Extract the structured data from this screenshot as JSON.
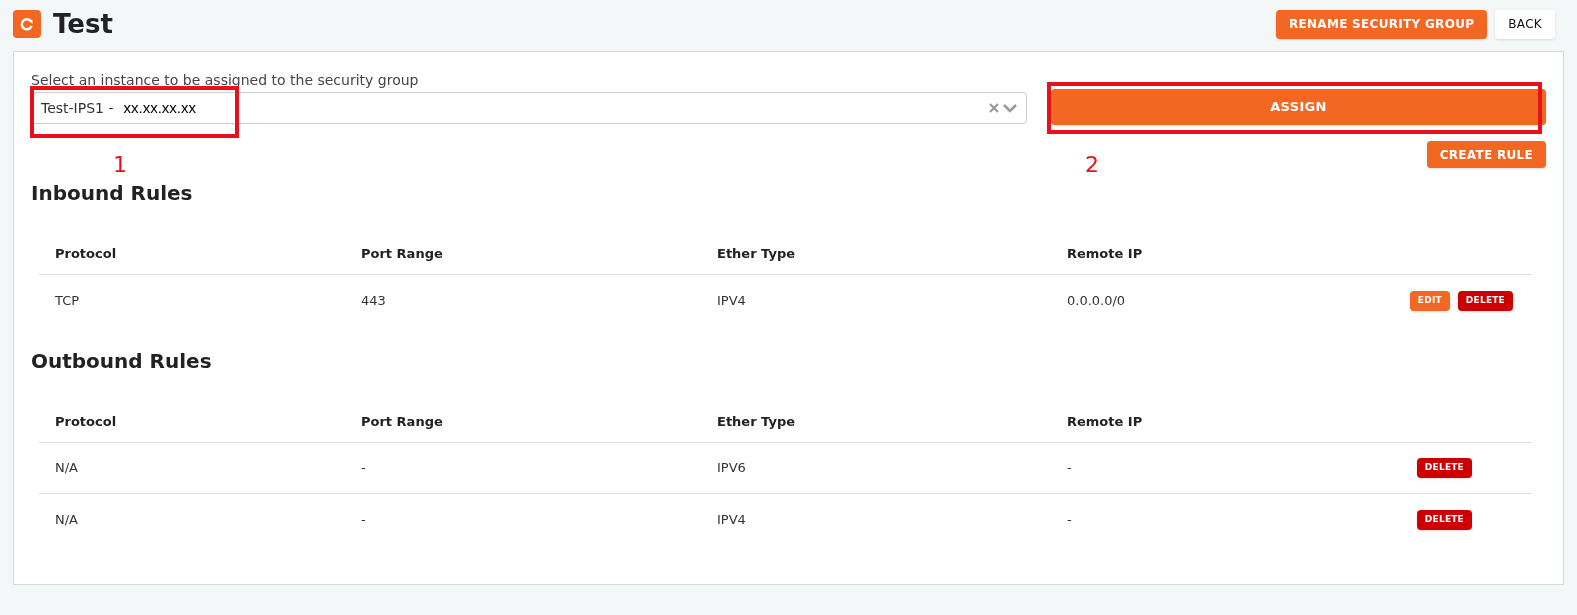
{
  "header": {
    "title": "Test",
    "buttons": [
      {
        "label": "RENAME SECURITY GROUP",
        "kind": "primary"
      },
      {
        "label": "BACK",
        "kind": "plain"
      }
    ]
  },
  "instance_select": {
    "label": "Select an instance to be assigned to the security group",
    "value_name": "Test-IPS1 -",
    "value_ip": "xx.xx.xx.xx"
  },
  "assign_button": "ASSIGN",
  "create_rule_button": "CREATE RULE",
  "annotations": [
    {
      "label": "1"
    },
    {
      "label": "2"
    }
  ],
  "sections": [
    {
      "title": "Inbound Rules",
      "columns": [
        "Protocol",
        "Port Range",
        "Ether Type",
        "Remote IP"
      ],
      "rows": [
        {
          "cells": [
            "TCP",
            "443",
            "IPV4",
            "0.0.0.0/0"
          ],
          "actions": [
            {
              "label": "EDIT",
              "kind": "edit"
            },
            {
              "label": "DELETE",
              "kind": "delete"
            }
          ]
        }
      ]
    },
    {
      "title": "Outbound Rules",
      "columns": [
        "Protocol",
        "Port Range",
        "Ether Type",
        "Remote IP"
      ],
      "rows": [
        {
          "cells": [
            "N/A",
            "-",
            "IPV6",
            "-"
          ],
          "actions": [
            {
              "label": "DELETE",
              "kind": "delete"
            }
          ]
        },
        {
          "cells": [
            "N/A",
            "-",
            "IPV4",
            "-"
          ],
          "actions": [
            {
              "label": "DELETE",
              "kind": "delete"
            }
          ]
        }
      ]
    }
  ]
}
